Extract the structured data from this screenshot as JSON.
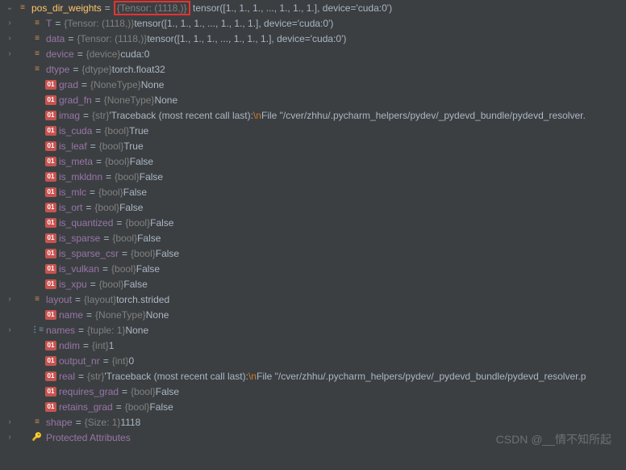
{
  "root": {
    "name": "pos_dir_weights",
    "boxed_type": "{Tensor: (1118,)}",
    "value": "tensor([1., 1., 1.,  ..., 1., 1., 1.], device='cuda:0')"
  },
  "rows": [
    {
      "indent": 1,
      "exp": ">",
      "icon": "field",
      "name": "T",
      "type": "{Tensor: (1118,)}",
      "value": "tensor([1., 1., 1.,  ..., 1., 1., 1.], device='cuda:0')"
    },
    {
      "indent": 1,
      "exp": ">",
      "icon": "field",
      "name": "data",
      "type": "{Tensor: (1118,)}",
      "value": "tensor([1., 1., 1.,  ..., 1., 1., 1.], device='cuda:0')"
    },
    {
      "indent": 1,
      "exp": ">",
      "icon": "field",
      "name": "device",
      "type": "{device}",
      "value": "cuda:0"
    },
    {
      "indent": 1,
      "exp": "",
      "icon": "field",
      "name": "dtype",
      "type": "{dtype}",
      "value": "torch.float32"
    },
    {
      "indent": 2,
      "exp": "",
      "icon": "prop",
      "name": "grad",
      "type": "{NoneType}",
      "value": "None"
    },
    {
      "indent": 2,
      "exp": "",
      "icon": "prop",
      "name": "grad_fn",
      "type": "{NoneType}",
      "value": "None"
    },
    {
      "indent": 2,
      "exp": "",
      "icon": "prop",
      "name": "imag",
      "type": "{str}",
      "value_pre": "'Traceback (most recent call last):",
      "esc": "\\n",
      "value_post": "  File \"/cver/zhhu/.pycharm_helpers/pydev/_pydevd_bundle/pydevd_resolver."
    },
    {
      "indent": 2,
      "exp": "",
      "icon": "prop",
      "name": "is_cuda",
      "type": "{bool}",
      "value": "True"
    },
    {
      "indent": 2,
      "exp": "",
      "icon": "prop",
      "name": "is_leaf",
      "type": "{bool}",
      "value": "True"
    },
    {
      "indent": 2,
      "exp": "",
      "icon": "prop",
      "name": "is_meta",
      "type": "{bool}",
      "value": "False"
    },
    {
      "indent": 2,
      "exp": "",
      "icon": "prop",
      "name": "is_mkldnn",
      "type": "{bool}",
      "value": "False"
    },
    {
      "indent": 2,
      "exp": "",
      "icon": "prop",
      "name": "is_mlc",
      "type": "{bool}",
      "value": "False"
    },
    {
      "indent": 2,
      "exp": "",
      "icon": "prop",
      "name": "is_ort",
      "type": "{bool}",
      "value": "False"
    },
    {
      "indent": 2,
      "exp": "",
      "icon": "prop",
      "name": "is_quantized",
      "type": "{bool}",
      "value": "False"
    },
    {
      "indent": 2,
      "exp": "",
      "icon": "prop",
      "name": "is_sparse",
      "type": "{bool}",
      "value": "False"
    },
    {
      "indent": 2,
      "exp": "",
      "icon": "prop",
      "name": "is_sparse_csr",
      "type": "{bool}",
      "value": "False"
    },
    {
      "indent": 2,
      "exp": "",
      "icon": "prop",
      "name": "is_vulkan",
      "type": "{bool}",
      "value": "False"
    },
    {
      "indent": 2,
      "exp": "",
      "icon": "prop",
      "name": "is_xpu",
      "type": "{bool}",
      "value": "False"
    },
    {
      "indent": 1,
      "exp": ">",
      "icon": "field",
      "name": "layout",
      "type": "{layout}",
      "value": "torch.strided"
    },
    {
      "indent": 2,
      "exp": "",
      "icon": "prop",
      "name": "name",
      "type": "{NoneType}",
      "value": "None"
    },
    {
      "indent": 1,
      "exp": ">",
      "icon": "list",
      "name": "names",
      "type": "{tuple: 1}",
      "value": "None"
    },
    {
      "indent": 2,
      "exp": "",
      "icon": "prop",
      "name": "ndim",
      "type": "{int}",
      "value": "1"
    },
    {
      "indent": 2,
      "exp": "",
      "icon": "prop",
      "name": "output_nr",
      "type": "{int}",
      "value": "0"
    },
    {
      "indent": 2,
      "exp": "",
      "icon": "prop",
      "name": "real",
      "type": "{str}",
      "value_pre": "'Traceback (most recent call last):",
      "esc": "\\n",
      "value_post": "  File \"/cver/zhhu/.pycharm_helpers/pydev/_pydevd_bundle/pydevd_resolver.p"
    },
    {
      "indent": 2,
      "exp": "",
      "icon": "prop",
      "name": "requires_grad",
      "type": "{bool}",
      "value": "False"
    },
    {
      "indent": 2,
      "exp": "",
      "icon": "prop",
      "name": "retains_grad",
      "type": "{bool}",
      "value": "False"
    },
    {
      "indent": 1,
      "exp": ">",
      "icon": "field",
      "name": "shape",
      "type": "{Size: 1}",
      "value": "1118"
    },
    {
      "indent": 1,
      "exp": ">",
      "icon": "key",
      "name": "Protected Attributes",
      "type": "",
      "value": ""
    }
  ],
  "watermark": "CSDN @__情不知所起"
}
